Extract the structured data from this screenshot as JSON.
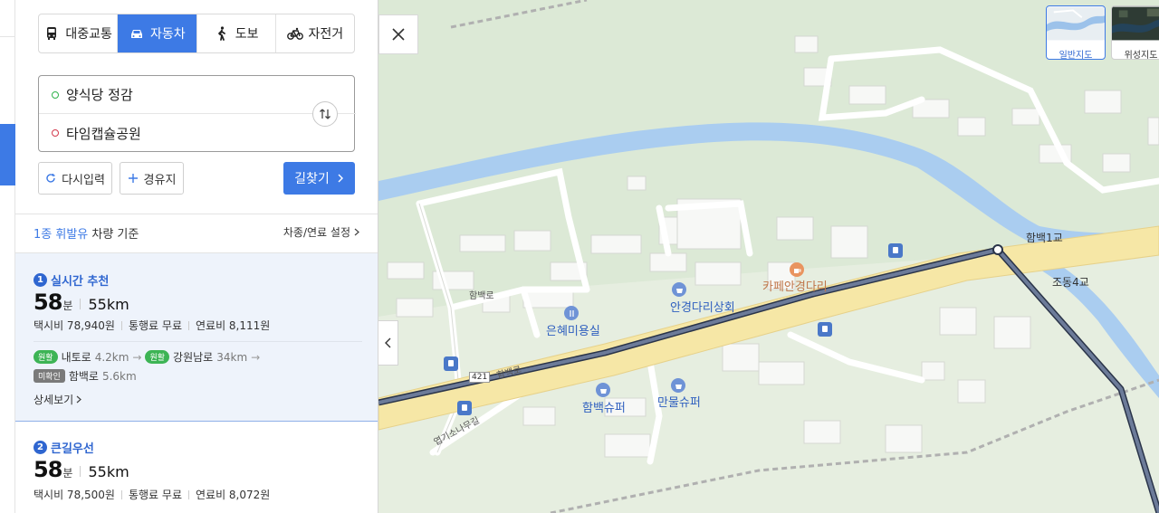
{
  "modes": [
    {
      "label": "대중교통",
      "icon": "bus-icon",
      "active": false
    },
    {
      "label": "자동차",
      "icon": "car-icon",
      "active": true
    },
    {
      "label": "도보",
      "icon": "walk-icon",
      "active": false
    },
    {
      "label": "자전거",
      "icon": "bicycle-icon",
      "active": false
    }
  ],
  "origin": "양식당 정감",
  "destination": "타임캡슐공원",
  "buttons": {
    "reset": "다시입력",
    "waypoint": "경유지",
    "search": "길찾기"
  },
  "basis": {
    "fuel": "1종 휘발유",
    "rest": " 차량 기준",
    "setting": "차종/연료 설정"
  },
  "routes": [
    {
      "num": "1",
      "title": "실시간 추천",
      "minutes": "58",
      "minutes_unit": "분",
      "distance": "55km",
      "taxi": "택시비 78,940원",
      "toll": "통행료 무료",
      "fuel": "연료비 8,111원",
      "roads": [
        {
          "status": "원활",
          "name": "내토로",
          "km": "4.2km"
        },
        {
          "status": "원활",
          "name": "강원남로",
          "km": "34km"
        },
        {
          "status": "미확인",
          "name": "함백로",
          "km": "5.6km"
        }
      ],
      "detail": "상세보기"
    },
    {
      "num": "2",
      "title": "큰길우선",
      "minutes": "58",
      "minutes_unit": "분",
      "distance": "55km",
      "taxi": "택시비 78,500원",
      "toll": "통행료 무료",
      "fuel": "연료비 8,072원"
    }
  ],
  "map": {
    "maptypes": [
      {
        "label": "일반지도",
        "active": true
      },
      {
        "label": "위성지도",
        "active": false
      }
    ],
    "labels": {
      "bridge": "함백1교",
      "jodong": "조동4교",
      "cafe": "카페안경다리",
      "store1": "안경다리상회",
      "salon": "은혜미용실",
      "super1": "함백슈퍼",
      "super2": "만물슈퍼",
      "road1": "함백로",
      "road2": "함백로",
      "road3": "엽기소나무길",
      "route421": "421"
    }
  },
  "colors": {
    "accent": "#3d7ae5",
    "route": "#4a5a78",
    "road": "#f6e7a6",
    "river": "#aacdf0",
    "green": "#dce9d6"
  }
}
